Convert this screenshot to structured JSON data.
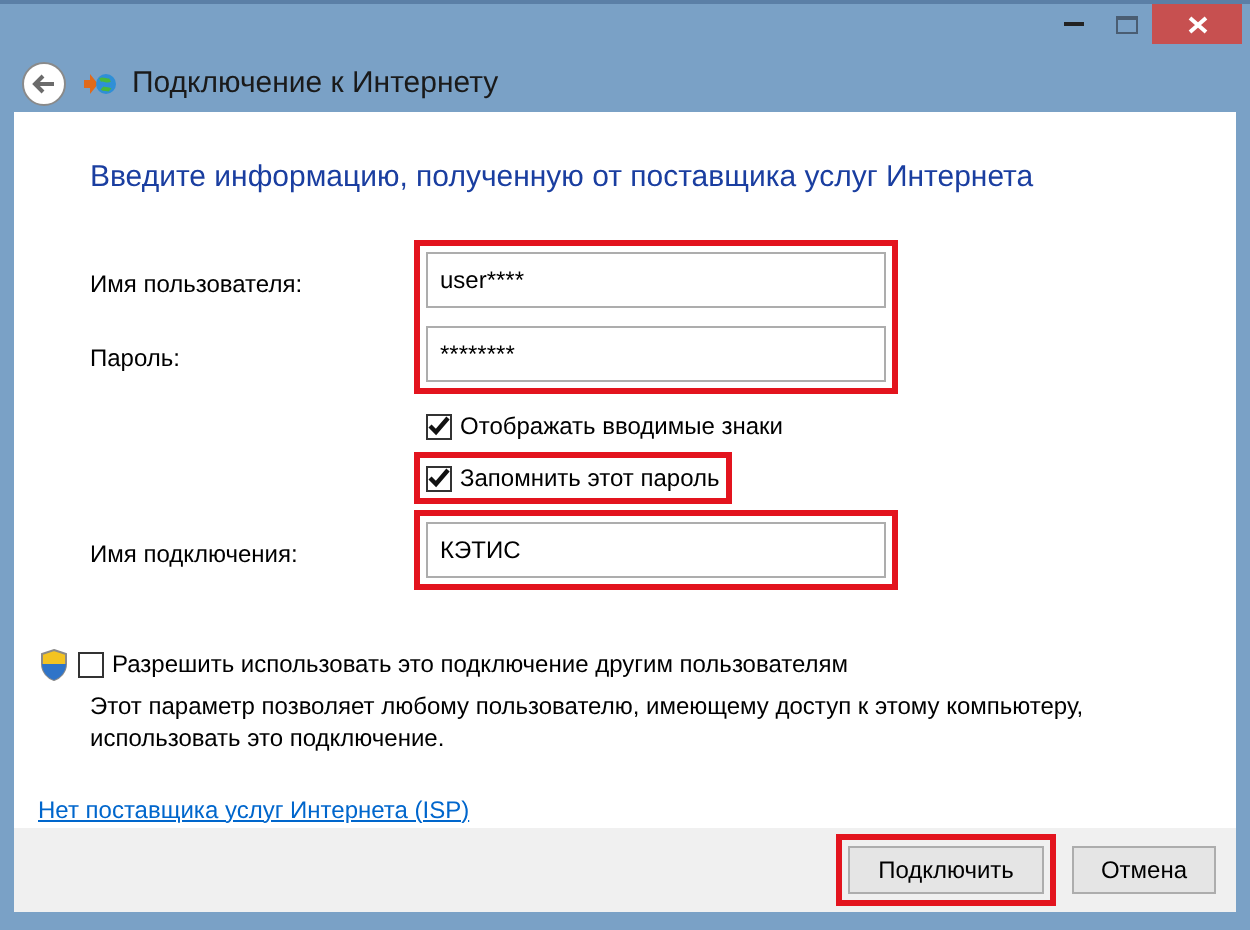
{
  "window": {
    "title": "Подключение к Интернету"
  },
  "heading": "Введите информацию, полученную от поставщика услуг Интернета",
  "form": [
    {
      "kind": "field-group",
      "highlighted": true,
      "fields": [
        {
          "label": "Имя пользователя:",
          "value": "user****"
        },
        {
          "label": "Пароль:",
          "value": "********"
        }
      ]
    },
    {
      "kind": "checkbox",
      "label": "Отображать вводимые знаки",
      "checked": true,
      "highlighted": false
    },
    {
      "kind": "checkbox",
      "label": "Запомнить этот пароль",
      "checked": true,
      "highlighted": true
    },
    {
      "kind": "field-group",
      "highlighted": true,
      "fields": [
        {
          "label": "Имя подключения:",
          "value": "КЭТИС"
        }
      ]
    }
  ],
  "share": {
    "label": "Разрешить использовать это подключение другим пользователям",
    "checked": false,
    "description": "Этот параметр позволяет любому пользователю, имеющему доступ к этому компьютеру, использовать это подключение."
  },
  "link": "Нет поставщика услуг Интернета (ISP)",
  "buttons": [
    {
      "label": "Подключить",
      "highlighted": true
    },
    {
      "label": "Отмена",
      "highlighted": false
    }
  ]
}
